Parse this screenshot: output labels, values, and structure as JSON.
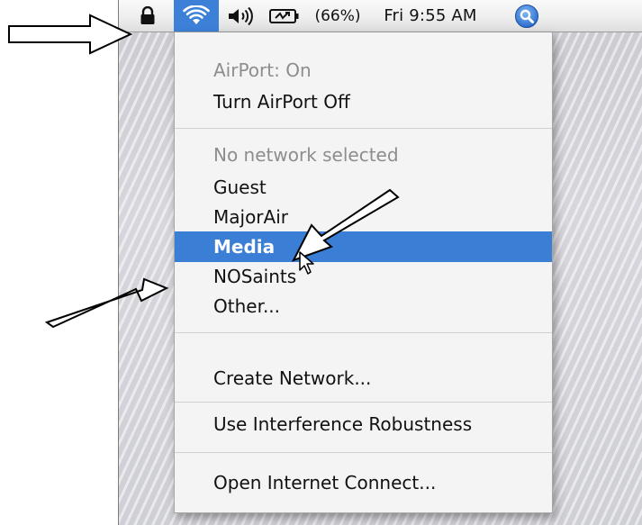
{
  "menubar": {
    "lock_icon": "lock-icon",
    "wifi_icon": "airport-wifi-icon",
    "volume_icon": "volume-icon",
    "battery_icon": "battery-charging-icon",
    "battery_percent": "(66%)",
    "clock": "Fri 9:55 AM",
    "spotlight_icon": "spotlight-search-icon",
    "accent": "#3c80d8"
  },
  "menu": {
    "status": "AirPort: On",
    "toggle": "Turn AirPort Off",
    "network_status": "No network selected",
    "networks": [
      "Guest",
      "MajorAir",
      "Media",
      "NOSaints",
      "Other..."
    ],
    "selected_network": "Media",
    "create_network": "Create Network...",
    "interference": "Use Interference Robustness",
    "open_connect": "Open Internet Connect..."
  },
  "annotations": {
    "arrow_icon": "callout-arrow-icon",
    "stroke": "#000000",
    "fill": "#ffffff"
  }
}
